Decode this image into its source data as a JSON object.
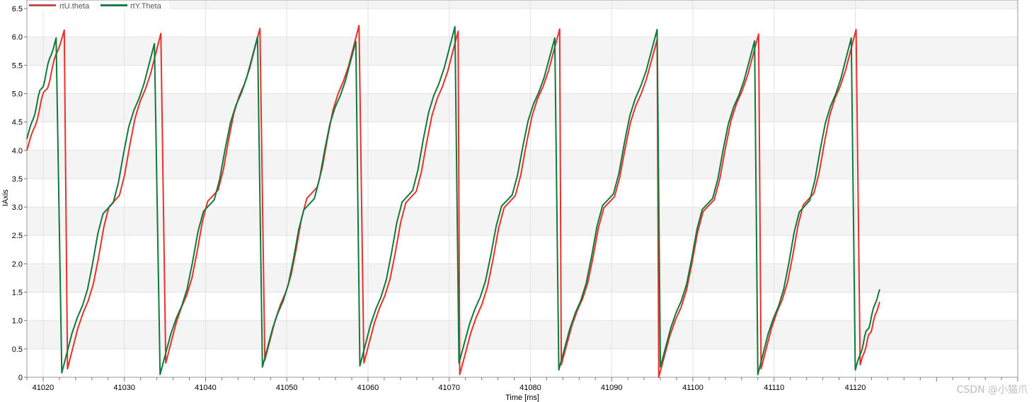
{
  "chart_data": {
    "type": "line",
    "xlabel": "Time [ms]",
    "ylabel": "IAxis",
    "xlim": [
      41018,
      41140
    ],
    "ylim": [
      0,
      6.65
    ],
    "x_ticks": [
      41020,
      41030,
      41040,
      41050,
      41060,
      41070,
      41080,
      41090,
      41100,
      41110,
      41120
    ],
    "y_ticks": [
      0,
      0.5,
      1.0,
      1.5,
      2.0,
      2.5,
      3.0,
      3.5,
      4.0,
      4.5,
      5.0,
      5.5,
      6.0,
      6.5
    ],
    "y_tick_labels": [
      "0",
      "0.5",
      "1.0",
      "1.5",
      "2.0",
      "2.5",
      "3.0",
      "3.5",
      "4.0",
      "4.5",
      "5.0",
      "5.5",
      "6.0",
      "6.5"
    ],
    "grid": true,
    "legend_position": "top-left",
    "series": [
      {
        "name": "rtU.theta",
        "color": "#e8312b",
        "legend_color": "#c0504d",
        "cycles": [
          {
            "start_x": 41018.0,
            "start_y": 4.0,
            "peak_x": 41022.6,
            "peak_y": 6.12,
            "low_x": 41023.0,
            "low_y": 0.15
          },
          {
            "start_x": 41023.0,
            "start_y": 0.15,
            "peak_x": 41034.5,
            "peak_y": 6.06,
            "low_x": 41035.1,
            "low_y": 0.25
          },
          {
            "start_x": 41035.1,
            "start_y": 0.25,
            "peak_x": 41046.7,
            "peak_y": 6.15,
            "low_x": 41047.3,
            "low_y": 0.3
          },
          {
            "start_x": 41047.3,
            "start_y": 0.3,
            "peak_x": 41058.9,
            "peak_y": 6.2,
            "low_x": 41059.5,
            "low_y": 0.25
          },
          {
            "start_x": 41059.5,
            "start_y": 0.25,
            "peak_x": 41071.1,
            "peak_y": 6.1,
            "low_x": 41071.3,
            "low_y": 0.05
          },
          {
            "start_x": 41071.3,
            "start_y": 0.05,
            "peak_x": 41083.6,
            "peak_y": 6.14,
            "low_x": 41083.8,
            "low_y": 0.22
          },
          {
            "start_x": 41083.8,
            "start_y": 0.22,
            "peak_x": 41095.6,
            "peak_y": 5.95,
            "low_x": 41095.8,
            "low_y": 0.0
          },
          {
            "start_x": 41095.8,
            "start_y": 0.0,
            "peak_x": 41108.1,
            "peak_y": 6.05,
            "low_x": 41108.4,
            "low_y": 0.15
          },
          {
            "start_x": 41108.4,
            "start_y": 0.15,
            "peak_x": 41120.1,
            "peak_y": 6.13,
            "low_x": 41120.6,
            "low_y": 0.22
          },
          {
            "start_x": 41120.6,
            "start_y": 0.22,
            "peak_x": 41123.0,
            "peak_y": 1.33,
            "low_x": null,
            "low_y": null
          }
        ]
      },
      {
        "name": "rtY.Theta",
        "color": "#0f7a3d",
        "legend_color": "#1f7a4a",
        "cycles": [
          {
            "start_x": 41018.0,
            "start_y": 4.2,
            "peak_x": 41021.6,
            "peak_y": 5.98,
            "low_x": 41022.3,
            "low_y": 0.08
          },
          {
            "start_x": 41022.3,
            "start_y": 0.08,
            "peak_x": 41033.7,
            "peak_y": 5.88,
            "low_x": 41034.4,
            "low_y": 0.05
          },
          {
            "start_x": 41034.4,
            "start_y": 0.05,
            "peak_x": 41046.4,
            "peak_y": 6.0,
            "low_x": 41047.0,
            "low_y": 0.18
          },
          {
            "start_x": 41047.0,
            "start_y": 0.18,
            "peak_x": 41058.5,
            "peak_y": 5.92,
            "low_x": 41059.0,
            "low_y": 0.2
          },
          {
            "start_x": 41059.0,
            "start_y": 0.2,
            "peak_x": 41070.7,
            "peak_y": 6.18,
            "low_x": 41071.2,
            "low_y": 0.25
          },
          {
            "start_x": 41071.2,
            "start_y": 0.25,
            "peak_x": 41083.0,
            "peak_y": 5.98,
            "low_x": 41083.5,
            "low_y": 0.13
          },
          {
            "start_x": 41083.5,
            "start_y": 0.13,
            "peak_x": 41095.6,
            "peak_y": 6.13,
            "low_x": 41096.0,
            "low_y": 0.18
          },
          {
            "start_x": 41096.0,
            "start_y": 0.18,
            "peak_x": 41107.6,
            "peak_y": 5.93,
            "low_x": 41108.0,
            "low_y": 0.05
          },
          {
            "start_x": 41108.0,
            "start_y": 0.05,
            "peak_x": 41119.5,
            "peak_y": 5.98,
            "low_x": 41120.0,
            "low_y": 0.13
          },
          {
            "start_x": 41120.0,
            "start_y": 0.13,
            "peak_x": 41123.0,
            "peak_y": 1.55,
            "low_x": null,
            "low_y": null
          }
        ]
      }
    ]
  },
  "legend": {
    "item1": "rtU.theta",
    "item2": "rtY.Theta"
  },
  "watermark": "CSDN @小猫爪"
}
